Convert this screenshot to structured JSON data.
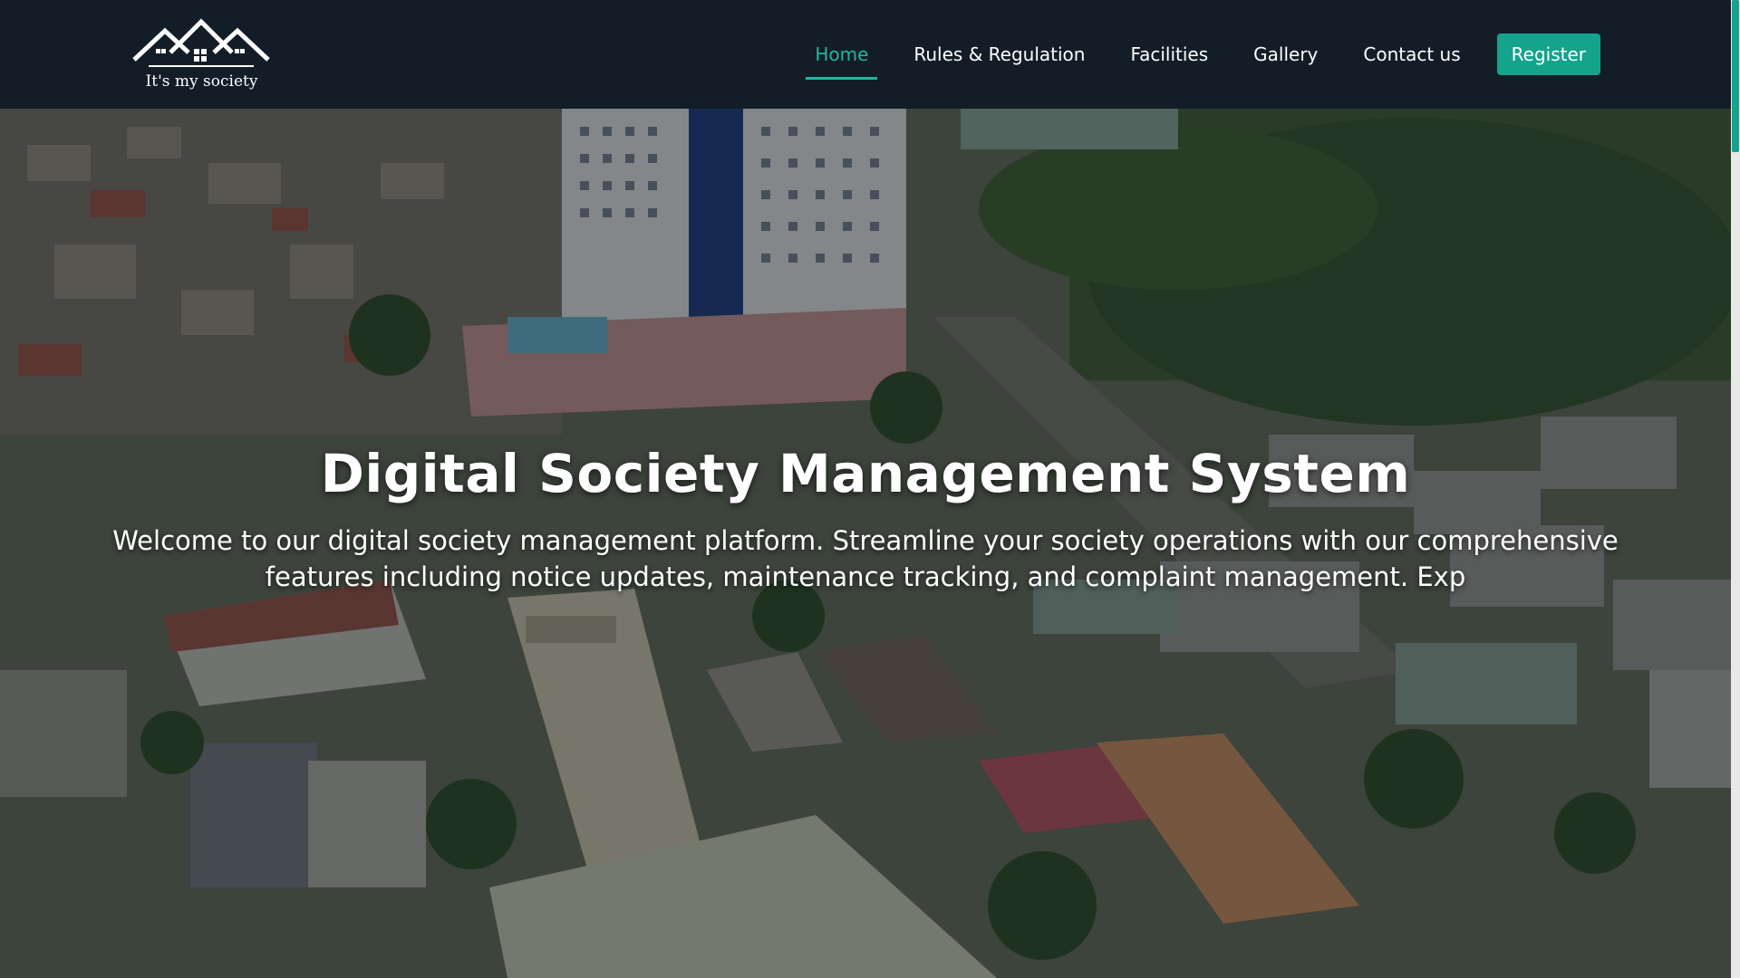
{
  "brand": {
    "tagline": "It's my society",
    "logo_icon": "house-roofs-icon"
  },
  "nav": {
    "items": [
      {
        "label": "Home",
        "active": true
      },
      {
        "label": "Rules & Regulation",
        "active": false
      },
      {
        "label": "Facilities",
        "active": false
      },
      {
        "label": "Gallery",
        "active": false
      },
      {
        "label": "Contact us",
        "active": false
      }
    ],
    "register_label": "Register"
  },
  "hero": {
    "title": "Digital Society Management System",
    "description": "Welcome to our digital society management platform. Streamline your society operations with our comprehensive features including notice updates, maintenance tracking, and complaint management. Exp"
  },
  "colors": {
    "header_bg": "#121d27",
    "accent": "#1fb7a0",
    "button_bg": "#14a38c",
    "text": "#ffffff"
  }
}
